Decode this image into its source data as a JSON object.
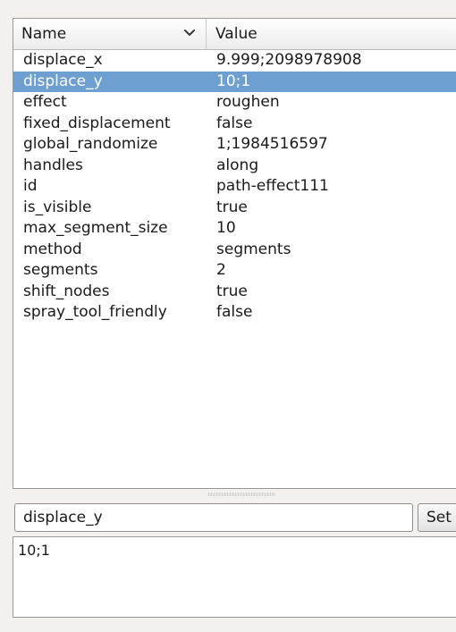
{
  "table": {
    "header": {
      "name_label": "Name",
      "value_label": "Value",
      "sort_icon": "chevron-down-icon"
    },
    "rows": [
      {
        "name": "displace_x",
        "value": "9.999;2098978908",
        "selected": false
      },
      {
        "name": "displace_y",
        "value": "10;1",
        "selected": true
      },
      {
        "name": "effect",
        "value": "roughen",
        "selected": false
      },
      {
        "name": "fixed_displacement",
        "value": "false",
        "selected": false
      },
      {
        "name": "global_randomize",
        "value": "1;1984516597",
        "selected": false
      },
      {
        "name": "handles",
        "value": "along",
        "selected": false
      },
      {
        "name": "id",
        "value": "path-effect111",
        "selected": false
      },
      {
        "name": "is_visible",
        "value": "true",
        "selected": false
      },
      {
        "name": "max_segment_size",
        "value": "10",
        "selected": false
      },
      {
        "name": "method",
        "value": "segments",
        "selected": false
      },
      {
        "name": "segments",
        "value": "2",
        "selected": false
      },
      {
        "name": "shift_nodes",
        "value": "true",
        "selected": false
      },
      {
        "name": "spray_tool_friendly",
        "value": "false",
        "selected": false
      }
    ]
  },
  "editor": {
    "attribute_name_value": "displace_y",
    "set_label": "Set",
    "attribute_value": "10;1"
  },
  "colors": {
    "selection": "#6e9fd1",
    "panel_background": "#f2f1f0"
  }
}
